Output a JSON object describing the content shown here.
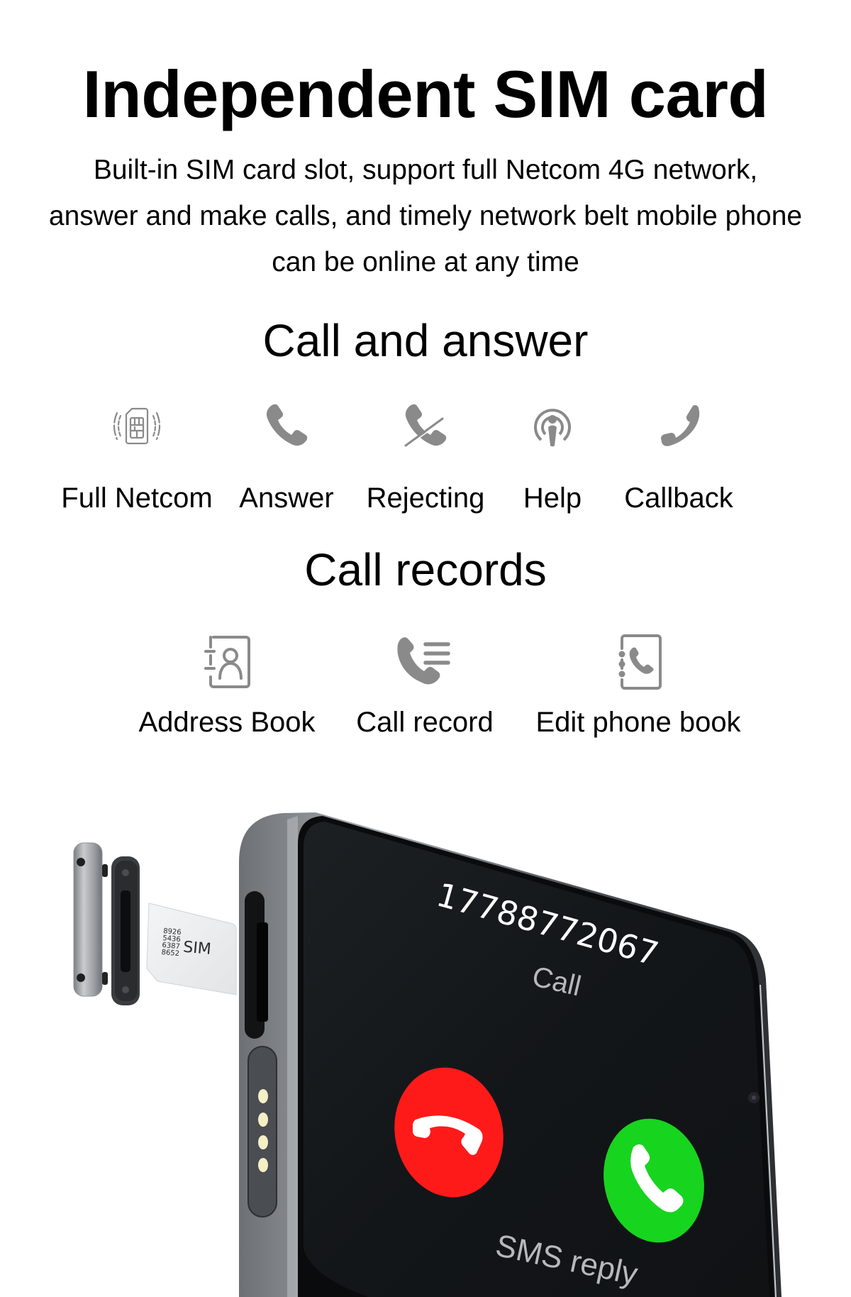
{
  "header": {
    "title": "Independent SIM card",
    "description_lines": [
      "Built-in SIM card slot, support full Netcom 4G network,",
      "answer and make calls, and timely network belt mobile phone",
      "can be online at any time"
    ]
  },
  "call_and_answer": {
    "heading": "Call and answer",
    "features": [
      {
        "label": "Full Netcom",
        "icon": "sim-signal-icon"
      },
      {
        "label": "Answer",
        "icon": "phone-icon"
      },
      {
        "label": "Rejecting",
        "icon": "phone-crossed-icon"
      },
      {
        "label": "Help",
        "icon": "broadcast-person-icon"
      },
      {
        "label": "Callback",
        "icon": "phone-callback-icon"
      }
    ]
  },
  "call_records": {
    "heading": "Call records",
    "features": [
      {
        "label": "Address Book",
        "icon": "contact-book-icon"
      },
      {
        "label": "Call record",
        "icon": "phone-list-icon"
      },
      {
        "label": "Edit phone book",
        "icon": "phone-book-icon"
      }
    ]
  },
  "product_image": {
    "sim_card": {
      "number_lines": [
        "8926",
        "5436",
        "6387",
        "8652"
      ],
      "label": "SIM"
    },
    "phone_screen": {
      "caller_number": "17788772067",
      "status": "Call",
      "sms_label": "SMS reply",
      "decline_color": "#ff1a1a",
      "accept_color": "#17d41f"
    }
  },
  "colors": {
    "icon_gray": "#8a8a8a",
    "text": "#000000",
    "background": "#ffffff",
    "screen": "#141719"
  }
}
